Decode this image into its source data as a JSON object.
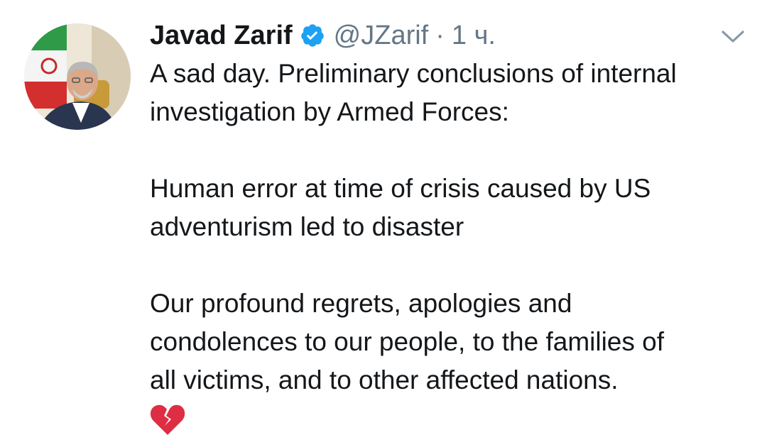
{
  "tweet": {
    "author_name": "Javad Zarif",
    "handle": "@JZarif",
    "separator": "·",
    "time": "1 ч.",
    "paragraphs": [
      [
        "A sad day. Preliminary conclusions of internal",
        "investigation by Armed Forces:"
      ],
      [
        "Human error at time of crisis caused by US",
        "adventurism led to disaster"
      ],
      [
        "Our profound regrets, apologies and",
        "condolences to our people, to the families of",
        "all victims, and to other affected nations."
      ]
    ],
    "emoji": "broken-heart-icon"
  },
  "icons": {
    "verified": "verified-badge-icon",
    "menu": "chevron-down-icon"
  },
  "colors": {
    "text": "#14171a",
    "secondary": "#657786",
    "verified_blue": "#1da1f2",
    "emoji_red": "#dd2e44"
  }
}
